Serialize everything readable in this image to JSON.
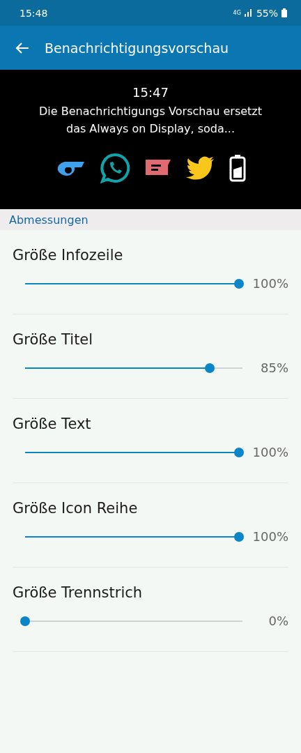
{
  "status_bar": {
    "time": "15:48",
    "network": "4G",
    "battery": "55%"
  },
  "app_bar": {
    "title": "Benachrichtigungsvorschau"
  },
  "preview": {
    "time": "15:47",
    "text": "Die Benachrichtigungs Vorschau ersetzt das Always on Display, soda..."
  },
  "section": {
    "title": "Abmessungen"
  },
  "settings": [
    {
      "label": "Größe Infozeile",
      "level": 1,
      "reading": "100%"
    },
    {
      "label": "Größe Titel",
      "level": 0.85,
      "reading": "85%"
    },
    {
      "label": "Größe Text",
      "level": 1,
      "reading": "100%"
    },
    {
      "label": "Größe Icon Reihe",
      "level": 1,
      "reading": "100%"
    },
    {
      "label": "Größe Trennstrich",
      "level": 0,
      "reading": "0%"
    }
  ]
}
